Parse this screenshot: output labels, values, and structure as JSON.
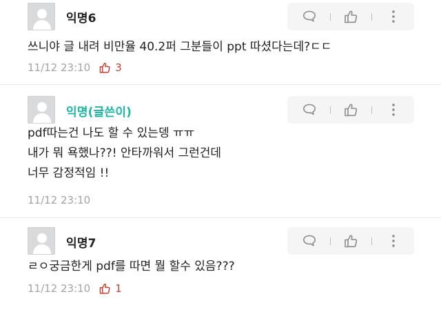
{
  "comments": [
    {
      "author": "익명6",
      "is_op": false,
      "lines": [
        "쓰니야 글 내려 비만율 40.2퍼 그분들이 ppt 따셨다는데?ㄷㄷ"
      ],
      "timestamp": "11/12 23:10",
      "likes": "3"
    },
    {
      "author": "익명(글쓴이)",
      "is_op": true,
      "lines": [
        "pdf따는건 나도 할 수 있는뎅 ㅠㅠ",
        "내가 뭐 욕했나??! 안타까워서 그런건데",
        "너무 감정적임 !!"
      ],
      "timestamp": "11/12 23:10",
      "likes": ""
    },
    {
      "author": "익명7",
      "is_op": false,
      "lines": [
        "ㄹㅇ궁금한게 pdf를 따면 뭘 할수 있음???"
      ],
      "timestamp": "11/12 23:10",
      "likes": "1"
    }
  ],
  "icons": {
    "reply": "speech-bubble-icon",
    "like": "thumbs-up-icon",
    "more": "vertical-dots-icon",
    "liked": "thumbs-up-outline-icon"
  },
  "colors": {
    "op_author": "#1bb7a5",
    "like_count": "#d23a2c",
    "meta_text": "#a3a3a3",
    "action_bar_bg": "#f5f5f5"
  }
}
